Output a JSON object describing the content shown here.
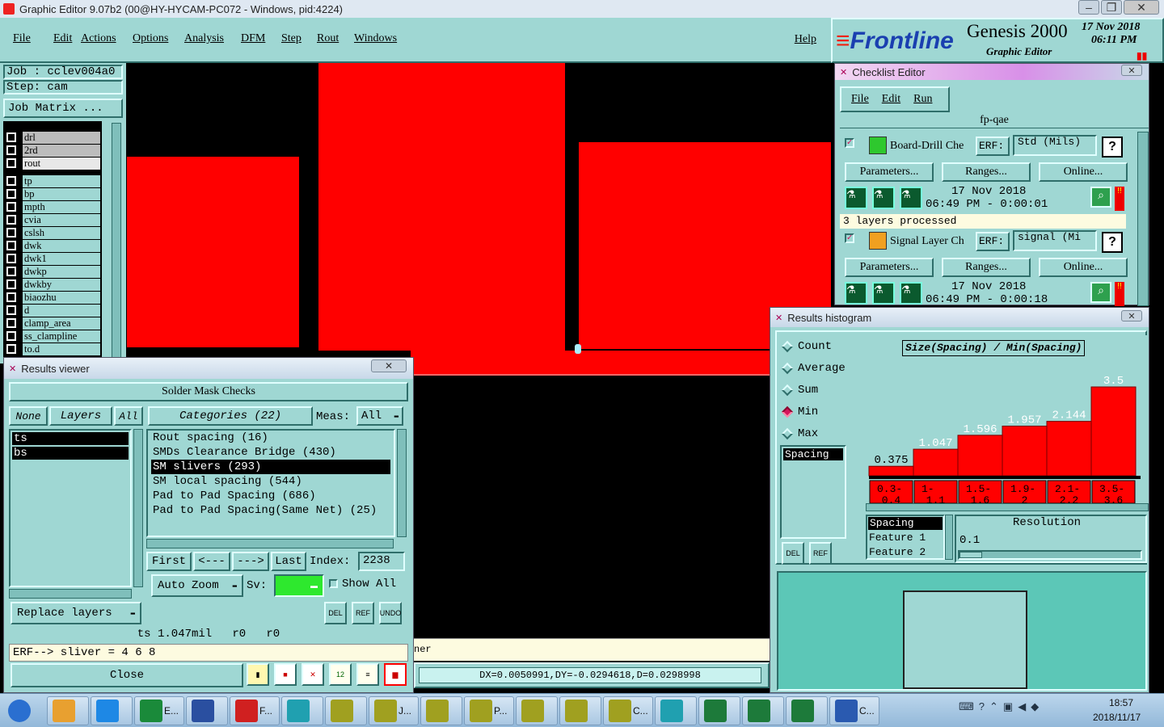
{
  "window": {
    "title": "Graphic Editor 9.07b2 (00@HY-HYCAM-PC072 - Windows, pid:4224)"
  },
  "menu": {
    "items": [
      "File",
      "Edit",
      "Actions",
      "Options",
      "Analysis",
      "DFM",
      "Step",
      "Rout",
      "Windows"
    ],
    "help": "Help"
  },
  "brand": {
    "logo": "Frontline",
    "product": "Genesis 2000",
    "subtitle": "Graphic Editor",
    "date": "17 Nov 2018",
    "time": "06:11 PM"
  },
  "job": {
    "job_line": "Job : cclev004a0",
    "step_line": "Step: cam",
    "matrix_button": "Job Matrix ..."
  },
  "layers": [
    "drl",
    "2rd",
    "rout",
    "tp",
    "bp",
    "mpth",
    "cvia",
    "cslsh",
    "dwk",
    "dwk1",
    "dwkp",
    "dwkby",
    "biaozhu",
    "d",
    "clamp_area",
    "ss_clampline",
    "to.d"
  ],
  "checklist": {
    "title": "Checklist Editor",
    "menu": [
      "File",
      "Edit",
      "Run"
    ],
    "name": "fp-qae",
    "items": [
      {
        "name": "Board-Drill Che",
        "erf_label": "ERF:",
        "erf_value": "Std (Mils)",
        "help": "?",
        "params": "Parameters...",
        "ranges": "Ranges...",
        "online": "Online...",
        "date": "17 Nov 2018",
        "time_line": "06:49 PM - 0:00:01",
        "status": "3 layers processed"
      },
      {
        "name": "Signal Layer Ch",
        "erf_label": "ERF:",
        "erf_value": "signal (Mi",
        "help": "?",
        "params": "Parameters...",
        "ranges": "Ranges...",
        "online": "Online...",
        "date": "17 Nov 2018",
        "time_line": "06:49 PM - 0:00:18"
      }
    ]
  },
  "results_viewer": {
    "title": "Results viewer",
    "header": "Solder Mask Checks",
    "none": "None",
    "layers": "Layers",
    "all": "All",
    "categories_label": "Categories (22)",
    "meas_label": "Meas:",
    "meas_value": "All",
    "layer_list": [
      "ts",
      "bs"
    ],
    "categories": [
      "Rout spacing (16)",
      "SMDs Clearance Bridge (430)",
      "SM slivers (293)",
      "SM local spacing (544)",
      "Pad to Pad Spacing (686)",
      "Pad to Pad Spacing(Same Net) (25)"
    ],
    "nav": {
      "first": "First",
      "prev": "<---",
      "next": "--->",
      "last": "Last",
      "index_label": "Index:",
      "index_value": "2238"
    },
    "auto_zoom": "Auto Zoom",
    "sv_label": "Sv:",
    "show_all": "Show All",
    "replace_layers": "Replace layers",
    "measure_line": "ts 1.047mil   r0   r0",
    "erf_line": "ERF--> sliver = 4 6 8",
    "close": "Close",
    "tool_icons": {
      "del": "DEL",
      "ref": "REF",
      "undo": "UNDO"
    }
  },
  "histogram": {
    "title": "Results histogram",
    "options": [
      "Count",
      "Average",
      "Sum",
      "Min",
      "Max"
    ],
    "selected_option": "Min",
    "measure_list": [
      "Spacing"
    ],
    "chart_title": "Size(Spacing) / Min(Spacing)",
    "tool_icons": {
      "del": "DEL",
      "ref": "REF"
    },
    "attr_list": [
      "Spacing",
      "Feature 1",
      "Feature 2"
    ],
    "resolution_label": "Resolution",
    "resolution_value": "0.1"
  },
  "chart_data": {
    "type": "bar",
    "title": "Size(Spacing) / Min(Spacing)",
    "categories": [
      "0.3-0.4",
      "1-1.1",
      "1.5-1.6",
      "1.9-2",
      "2.1-2.2",
      "3.5-3.6"
    ],
    "category_top": [
      "0.3-",
      "1-",
      "1.5-",
      "1.9-",
      "2.1-",
      "3.5-"
    ],
    "category_bottom": [
      "0.4",
      "1.1",
      "1.6",
      "2",
      "2.2",
      "3.6"
    ],
    "values": [
      0.375,
      1.047,
      1.596,
      1.957,
      2.144,
      3.5
    ],
    "labels": [
      "0.375",
      "1.047",
      "1.596",
      "1.957",
      "2.144",
      "3.5"
    ],
    "ylim": [
      0,
      3.5
    ],
    "bar_color": "#ff0000"
  },
  "status": {
    "dxdy": "DX=0.0050991,DY=-0.0294618,D=0.0298998",
    "partial": "ner"
  },
  "colors": {
    "teal": "#9fd7d3",
    "red": "#ff0000",
    "canvas": "#000000",
    "highlight": "#d4145a"
  },
  "taskbar": {
    "items": [
      {
        "icon": "start-orb-icon",
        "label": ""
      },
      {
        "icon": "shell-icon",
        "label": ""
      },
      {
        "icon": "ie-icon",
        "label": ""
      },
      {
        "icon": "frontline-icon",
        "label": "E..."
      },
      {
        "icon": "floppy-icon",
        "label": ""
      },
      {
        "icon": "genesis-icon",
        "label": "F..."
      },
      {
        "icon": "fish-icon",
        "label": ""
      },
      {
        "icon": "x-window-icon",
        "label": ""
      },
      {
        "icon": "x-window-icon",
        "label": "J..."
      },
      {
        "icon": "x-window-icon",
        "label": ""
      },
      {
        "icon": "x-window-icon",
        "label": "P..."
      },
      {
        "icon": "x-window-icon",
        "label": ""
      },
      {
        "icon": "x-window-icon",
        "label": ""
      },
      {
        "icon": "x-window-icon",
        "label": "C..."
      },
      {
        "icon": "fish-icon",
        "label": ""
      },
      {
        "icon": "excel-icon",
        "label": ""
      },
      {
        "icon": "excel-icon",
        "label": ""
      },
      {
        "icon": "excel-icon",
        "label": ""
      },
      {
        "icon": "word-icon",
        "label": "C..."
      }
    ],
    "clock_time": "18:57",
    "clock_date": "2018/11/17"
  }
}
